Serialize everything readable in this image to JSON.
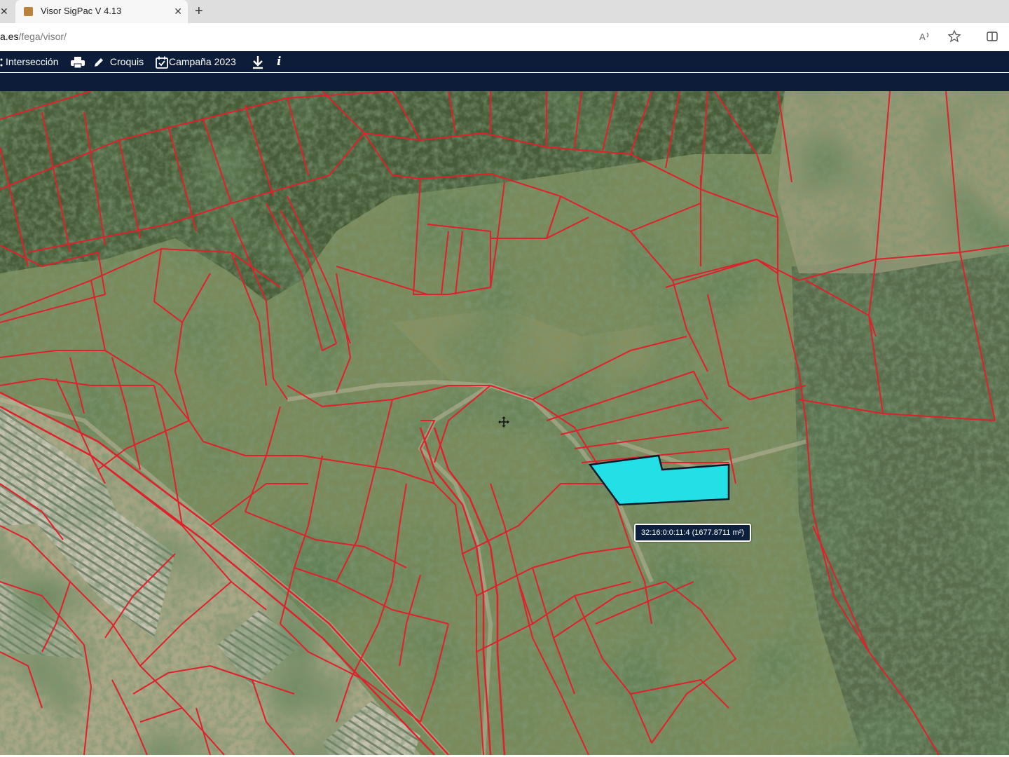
{
  "browser": {
    "tab_title": "Visor SigPac V 4.13",
    "url_host": "a.es",
    "url_path": "/fega/visor/"
  },
  "toolbar": {
    "intersection_label": "Intersección",
    "croquis_label": "Croquis",
    "campaign_label": "Campaña 2023",
    "info_label": "i"
  },
  "map": {
    "selected_parcel_label": "32:16:0:0:11:4 (1677.8711 m²)",
    "parcel_highlight_color": "#22e0e6",
    "boundary_color": "#e0202a"
  }
}
